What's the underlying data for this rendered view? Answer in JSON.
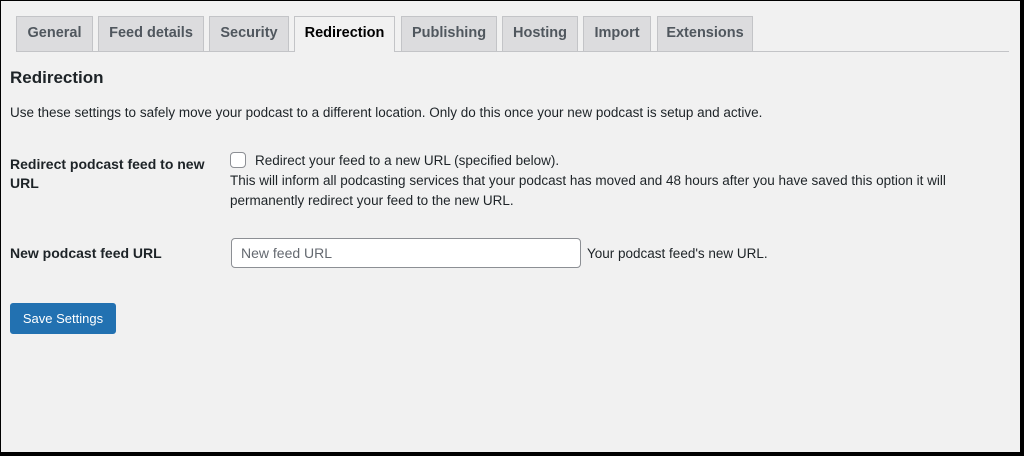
{
  "tabs": [
    {
      "label": "General",
      "active": false
    },
    {
      "label": "Feed details",
      "active": false
    },
    {
      "label": "Security",
      "active": false
    },
    {
      "label": "Redirection",
      "active": true
    },
    {
      "label": "Publishing",
      "active": false
    },
    {
      "label": "Hosting",
      "active": false
    },
    {
      "label": "Import",
      "active": false
    },
    {
      "label": "Extensions",
      "active": false
    }
  ],
  "section": {
    "title": "Redirection",
    "intro": "Use these settings to safely move your podcast to a different location. Only do this once your new podcast is setup and active."
  },
  "redirect_row": {
    "label": "Redirect podcast feed to new URL",
    "checkbox_label": "Redirect your feed to a new URL (specified below).",
    "checked": false,
    "description": "This will inform all podcasting services that your podcast has moved and 48 hours after you have saved this option it will permanently redirect your feed to the new URL."
  },
  "feed_url_row": {
    "label": "New podcast feed URL",
    "placeholder": "New feed URL",
    "value": "",
    "hint": "Your podcast feed's new URL."
  },
  "save_label": "Save Settings",
  "colors": {
    "background": "#f1f1f1",
    "primary_button": "#2271b1",
    "tab_inactive": "#dcdcde"
  }
}
